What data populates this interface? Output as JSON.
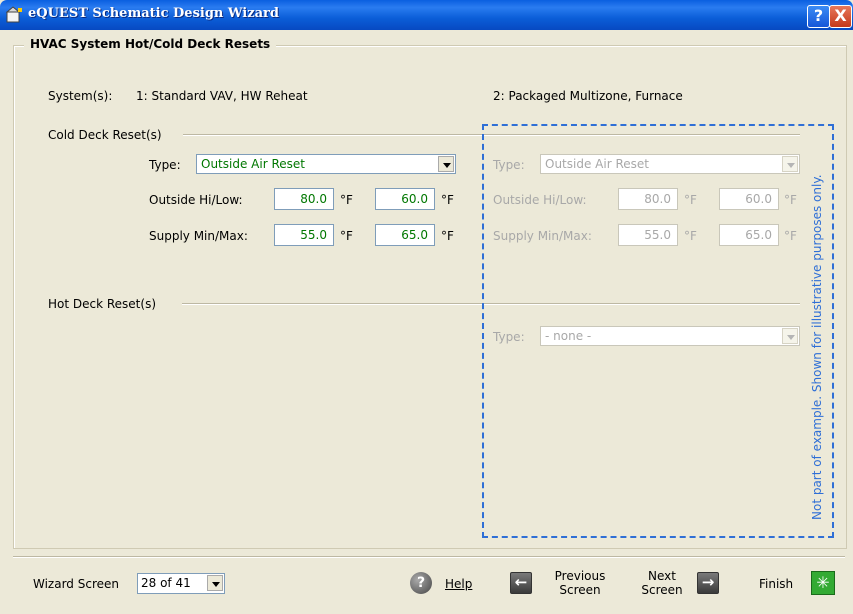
{
  "window": {
    "title": "eQUEST Schematic Design Wizard",
    "help_glyph": "?",
    "close_glyph": "X"
  },
  "section_title": "HVAC System Hot/Cold Deck Resets",
  "systems": {
    "label": "System(s):",
    "system1": "1: Standard VAV, HW Reheat",
    "system2": "2: Packaged Multizone, Furnace"
  },
  "cold_deck": {
    "heading": "Cold Deck Reset(s)",
    "type_label": "Type:",
    "outside_label": "Outside Hi/Low:",
    "supply_label": "Supply Min/Max:",
    "unit": "°F",
    "sys1": {
      "type": "Outside Air Reset",
      "outside_hi": "80.0",
      "outside_low": "60.0",
      "supply_min": "55.0",
      "supply_max": "65.0"
    },
    "sys2": {
      "type": "Outside Air Reset",
      "outside_hi": "80.0",
      "outside_low": "60.0",
      "supply_min": "55.0",
      "supply_max": "65.0"
    }
  },
  "hot_deck": {
    "heading": "Hot Deck Reset(s)",
    "type_label": "Type:",
    "sys2_type": "- none -"
  },
  "note": "Not part of example. Shown for illustrative purposes only.",
  "footer": {
    "wizard_label": "Wizard Screen",
    "wizard_value": "28 of 41",
    "help": "Help",
    "previous_line1": "Previous",
    "previous_line2": "Screen",
    "next_line1": "Next",
    "next_line2": "Screen",
    "finish": "Finish"
  },
  "colors": {
    "titlebar": "#0b5ed8",
    "value_green": "#007700",
    "note_blue": "#2f6fd6",
    "background": "#ece9d8"
  }
}
